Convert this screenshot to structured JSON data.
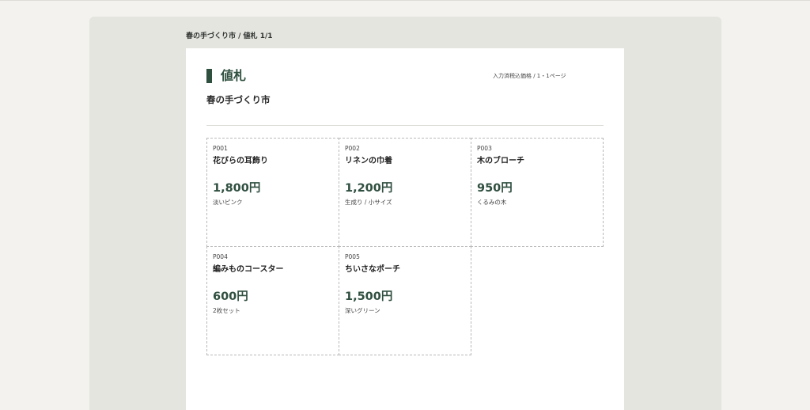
{
  "header": {
    "breadcrumb": "春の手づくり市 / 値札 1/1"
  },
  "document": {
    "title": "値札",
    "subtitle": "春の手づくり市",
    "page_meta": "入力済税込価格 / 1・1ページ"
  },
  "items": [
    {
      "code": "P001",
      "name": "花びらの耳飾り",
      "price": "1,800円",
      "note": "淡いピンク"
    },
    {
      "code": "P002",
      "name": "リネンの巾着",
      "price": "1,200円",
      "note": "生成り / 小サイズ"
    },
    {
      "code": "P003",
      "name": "木のブローチ",
      "price": "950円",
      "note": "くるみの木"
    },
    {
      "code": "P004",
      "name": "編みものコースター",
      "price": "600円",
      "note": "2枚セット"
    },
    {
      "code": "P005",
      "name": "ちいさなポーチ",
      "price": "1,500円",
      "note": "深いグリーン"
    }
  ],
  "colors": {
    "accent": "#2f4f3f",
    "workspace": "#e4e5df",
    "background": "#f3f2ee"
  }
}
